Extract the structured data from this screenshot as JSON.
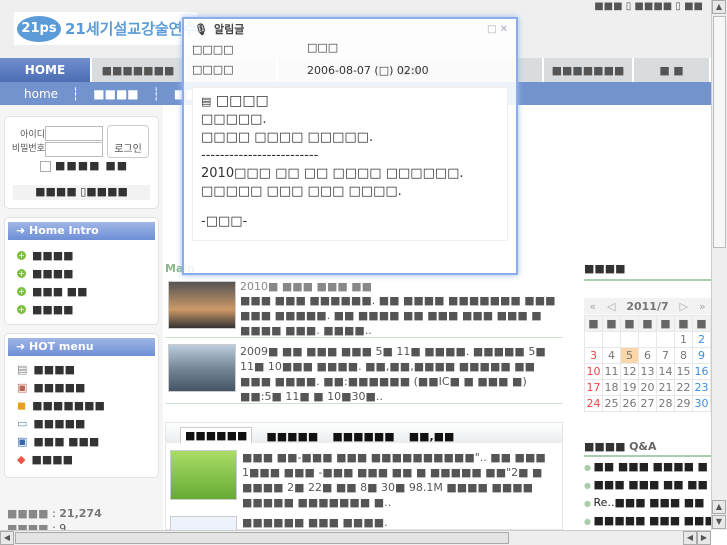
{
  "logo": {
    "badge": "21ps",
    "name": "21세기설교강술연수"
  },
  "top_links": [
    "■■■",
    "■■■■",
    "■■"
  ],
  "nav": {
    "home": "HOME",
    "tabs": [
      "■■■■■■■",
      "",
      "■■",
      "■■■■■■■",
      "■ ■"
    ]
  },
  "subnav": [
    "home",
    "■■■■",
    "■■■■"
  ],
  "login": {
    "id_label": "아이디",
    "pw_label": "비밀번호",
    "button": "로그인",
    "remember": "■■■■ ■■",
    "links": [
      "■■■■",
      "■■■■"
    ]
  },
  "home_intro": {
    "title": "Home Intro",
    "items": [
      "■■■■",
      "■■■■",
      "■■■ ■■",
      "■■■■"
    ]
  },
  "hot_menu": {
    "title": "HOT menu",
    "items": [
      {
        "icon": "newspaper-icon",
        "label": "■■■■"
      },
      {
        "icon": "gift-icon",
        "label": "■■■■■"
      },
      {
        "icon": "bag-icon",
        "label": "■■■■■■■"
      },
      {
        "icon": "bus-icon",
        "label": "■■■■■"
      },
      {
        "icon": "portrait-icon",
        "label": "■■■ ■■■"
      },
      {
        "icon": "lips-icon",
        "label": "■■■■"
      }
    ]
  },
  "counter": [
    {
      "label": "■■■■",
      "value": "21,274"
    },
    {
      "label": "■■■■",
      "value": "9"
    }
  ],
  "main": {
    "section_label": "Main",
    "news": [
      {
        "title": "2010■ ■■■ ■■■ ■■",
        "text": "■■■ ■■■ ■■■■■■. ■■ ■■■■ ■■■■■■■ ■■■ ■■■ ■■■■■. ■■ ■■■■ ■■ ■■■ ■■■ ■■■ ■ ■■■■ ■■■. ■■■■.."
      },
      {
        "title": "",
        "text": "2009■ ■■ ■■■ ■■■ 5■ 11■ ■■■■. ■■■■■ 5■ 11■ 10■■■ ■■■■. ■■,■■,■■■■ ■■■■■ ■■ ■■■ ■■■■. ■■:■■■■■■ (■■IC■ ■ ■■■ ■) ■■:5■ 11■ ■ 10■30■.."
      }
    ],
    "tabs": [
      "■■■■■■",
      "■■■■■",
      "■■■■■■",
      "■■,■■"
    ],
    "tab_items": [
      {
        "text": "■■■ ■■-■■■ ■■■ ■■■■■■■■■■\".. ■■ ■■■ 1■■■ ■■■ -■■■ ■■■ ■■ ■ ■■■■■ ■■\"2■ ■ ■■■■ 2■ 22■ ■■ 8■ 30■ 98.1M ■■■■ ■■■■ ■■■■■ ■■■■■■■ ■.."
      },
      {
        "text": "■■■■■■ ■■■ ■■■■."
      }
    ]
  },
  "popup": {
    "title": "알림글",
    "rows": [
      {
        "label": "□□□□",
        "value": "□□□"
      },
      {
        "label": "□□□□",
        "value": "2006-08-07 (□) 02:00"
      }
    ],
    "heading": "□□□□",
    "lines": [
      "□□□□□.",
      "□□□□ □□□□ □□□□□.",
      "-------------------------",
      "2010□□□ □□ □□ □□□□ □□□□□□.",
      "□□□□□ □□□ □□□ □□□□.",
      "",
      "-□□□-"
    ]
  },
  "calendar": {
    "title": "■■■■",
    "month": "2011/7",
    "weekdays": [
      "■",
      "■",
      "■",
      "■",
      "■",
      "■",
      "■"
    ],
    "weeks": [
      [
        "",
        "",
        "",
        "",
        "",
        "1",
        "2"
      ],
      [
        "3",
        "4",
        "5",
        "6",
        "7",
        "8",
        "9"
      ],
      [
        "10",
        "11",
        "12",
        "13",
        "14",
        "15",
        "16"
      ],
      [
        "17",
        "18",
        "19",
        "20",
        "21",
        "22",
        "23"
      ],
      [
        "24",
        "25",
        "26",
        "27",
        "28",
        "29",
        "30"
      ]
    ],
    "today": "5"
  },
  "qa": {
    "title": "■■■■",
    "title_suffix": "Q&A",
    "items": [
      "■■ ■■■ ■■■■ ■",
      "■■■ ■■■ ■■ ■■",
      "Re..■■■ ■■■ ■■",
      "■■■■■ ■■■ ■■■"
    ]
  }
}
